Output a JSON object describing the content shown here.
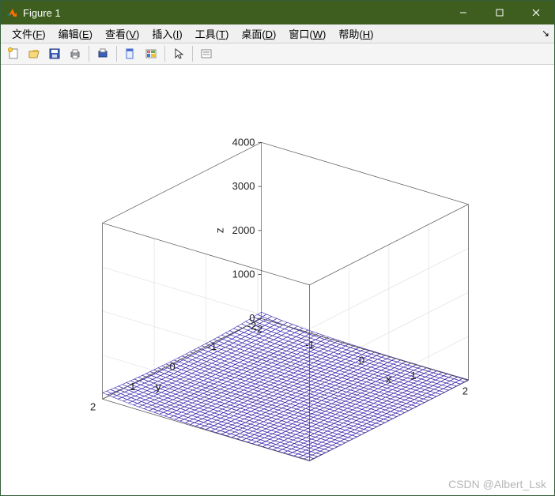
{
  "window": {
    "title": "Figure 1"
  },
  "menus": [
    {
      "id": "file",
      "label": "文件",
      "mnemonic": "F"
    },
    {
      "id": "edit",
      "label": "编辑",
      "mnemonic": "E"
    },
    {
      "id": "view",
      "label": "查看",
      "mnemonic": "V"
    },
    {
      "id": "insert",
      "label": "插入",
      "mnemonic": "I"
    },
    {
      "id": "tools",
      "label": "工具",
      "mnemonic": "T"
    },
    {
      "id": "desktop",
      "label": "桌面",
      "mnemonic": "D"
    },
    {
      "id": "window",
      "label": "窗口",
      "mnemonic": "W"
    },
    {
      "id": "help",
      "label": "帮助",
      "mnemonic": "H"
    }
  ],
  "toolbar": {
    "tips": {
      "new": "New",
      "open": "Open",
      "save": "Save",
      "print": "Print",
      "printpv": "Print Preview",
      "datacursor": "Data Cursor",
      "colorbar": "Colorbar",
      "pointer": "Pointer",
      "legend": "Legend"
    }
  },
  "axes": {
    "xlabel": "x",
    "ylabel": "y",
    "zlabel": "z",
    "xticks": [
      -2,
      -1,
      0,
      1,
      2
    ],
    "yticks": [
      -2,
      -1,
      0,
      1,
      2
    ],
    "zticks": [
      0,
      1000,
      2000,
      3000,
      4000
    ],
    "xlim": [
      -2,
      2
    ],
    "ylim": [
      -2,
      2
    ],
    "zlim": [
      0,
      4000
    ]
  },
  "watermark": "CSDN @Albert_Lsk",
  "chart_data": {
    "type": "surface",
    "title": "",
    "xlabel": "x",
    "ylabel": "y",
    "zlabel": "z",
    "x_range": [
      -2,
      2
    ],
    "y_range": [
      -2,
      2
    ],
    "grid_size": [
      40,
      40
    ],
    "function": "z = (x^2 + y^2 - 2*x)^2",
    "z_range_visible": [
      0,
      4000
    ],
    "sample_points": [
      {
        "x": -2,
        "y": -2,
        "z": 144
      },
      {
        "x": -2,
        "y": 0,
        "z": 64
      },
      {
        "x": -2,
        "y": 2,
        "z": 144
      },
      {
        "x": 0,
        "y": -2,
        "z": 16
      },
      {
        "x": 0,
        "y": 0,
        "z": 0
      },
      {
        "x": 0,
        "y": 2,
        "z": 16
      },
      {
        "x": 2,
        "y": -2,
        "z": 16
      },
      {
        "x": 2,
        "y": 0,
        "z": 0
      },
      {
        "x": 2,
        "y": 2,
        "z": 16
      },
      {
        "x": -2,
        "y": 1,
        "z": 81
      },
      {
        "x": -2,
        "y": -1,
        "z": 81
      }
    ],
    "colormap": "parula",
    "style": "mesh",
    "view_az": -37.5,
    "view_el": 30
  }
}
